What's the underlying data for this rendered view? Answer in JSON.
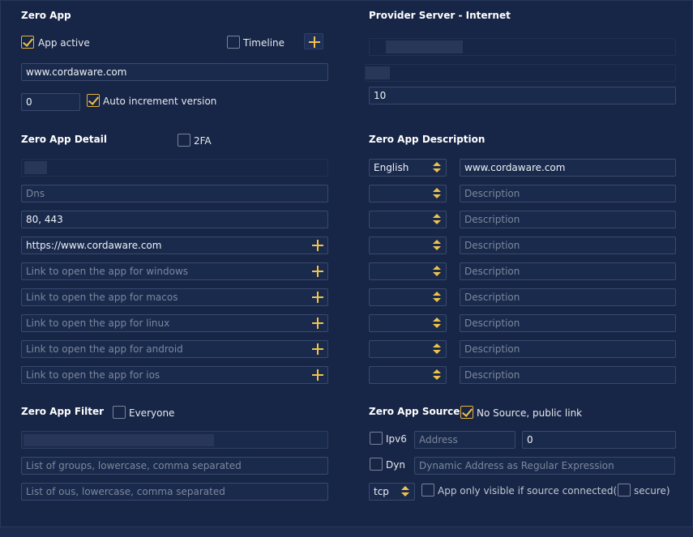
{
  "left": {
    "zero_app": {
      "title": "Zero App",
      "app_active_label": "App active",
      "app_active_checked": true,
      "timeline_label": "Timeline",
      "timeline_checked": false,
      "url_value": "www.cordaware.com",
      "version_value": "0",
      "auto_increment_label": "Auto increment version",
      "auto_increment_checked": true
    },
    "detail": {
      "title": "Zero App Detail",
      "twofa_label": "2FA",
      "twofa_checked": false,
      "dns_placeholder": "Dns",
      "ports_value": "80, 443",
      "link_value": "https://www.cordaware.com",
      "windows_placeholder": "Link to open the app for windows",
      "macos_placeholder": "Link to open the app for macos",
      "linux_placeholder": "Link to open the app for linux",
      "android_placeholder": "Link to open the app for android",
      "ios_placeholder": "Link to open the app for ios"
    },
    "filter": {
      "title": "Zero App Filter",
      "everyone_label": "Everyone",
      "everyone_checked": false,
      "groups_placeholder": "List of groups, lowercase, comma separated",
      "ous_placeholder": "List of ous, lowercase, comma separated"
    }
  },
  "right": {
    "provider": {
      "title": "Provider Server - Internet",
      "number_value": "10"
    },
    "description": {
      "title": "Zero App Description",
      "rows": [
        {
          "language": "English",
          "value": "www.cordaware.com",
          "placeholder": ""
        },
        {
          "language": "",
          "value": "",
          "placeholder": "Description"
        },
        {
          "language": "",
          "value": "",
          "placeholder": "Description"
        },
        {
          "language": "",
          "value": "",
          "placeholder": "Description"
        },
        {
          "language": "",
          "value": "",
          "placeholder": "Description"
        },
        {
          "language": "",
          "value": "",
          "placeholder": "Description"
        },
        {
          "language": "",
          "value": "",
          "placeholder": "Description"
        },
        {
          "language": "",
          "value": "",
          "placeholder": "Description"
        },
        {
          "language": "",
          "value": "",
          "placeholder": "Description"
        }
      ]
    },
    "source": {
      "title": "Zero App Source",
      "no_source_label": "No Source, public link",
      "no_source_checked": true,
      "ipv6_label": "Ipv6",
      "address_placeholder": "Address",
      "port_value": "0",
      "dyn_label": "Dyn",
      "dyn_placeholder": "Dynamic Address as Regular Expression",
      "protocol_value": "tcp",
      "visible_label": "App only visible if source connected(",
      "secure_label": "secure)"
    }
  },
  "colors": {
    "background": "#172546",
    "accent": "#f0c24a",
    "field_border": "#3a4a6c"
  },
  "icons": {
    "plus": "plus-icon",
    "check": "check-icon",
    "spinner": "spinner-arrows-icon"
  }
}
